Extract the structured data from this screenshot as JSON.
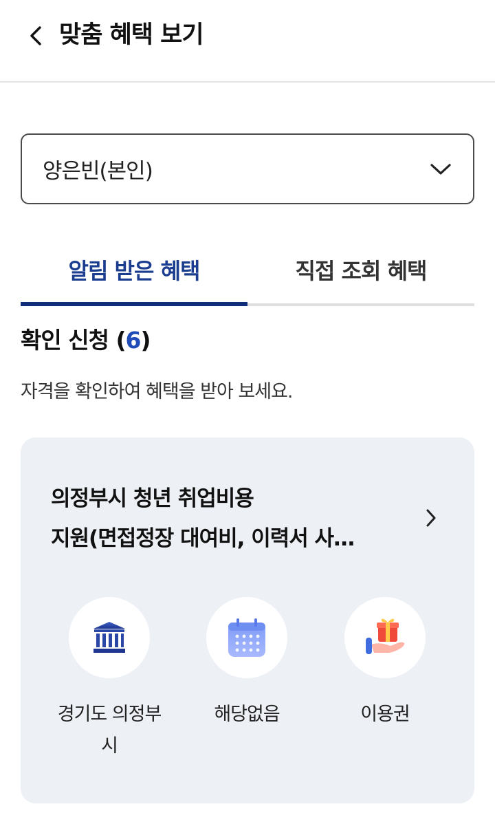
{
  "header": {
    "title": "맞춤 혜택 보기",
    "back_icon": "chevron-left-icon"
  },
  "member_select": {
    "value": "양은빈(본인)",
    "icon": "chevron-down-icon"
  },
  "tabs": [
    {
      "label": "알림 받은 혜택",
      "active": true
    },
    {
      "label": "직접 조회 혜택",
      "active": false
    }
  ],
  "section": {
    "title": "확인 신청",
    "count": "6",
    "description": "자격을 확인하여 혜택을 받아 보세요."
  },
  "benefit_card": {
    "title_line1": "의정부시 청년 취업비용",
    "title_line2": "지원(면접정장 대여비, 이력서 사…",
    "arrow_icon": "chevron-right-icon",
    "info": [
      {
        "icon": "government-building-icon",
        "label": "경기도 의정부시"
      },
      {
        "icon": "calendar-icon",
        "label": "해당없음"
      },
      {
        "icon": "gift-hand-icon",
        "label": "이용권"
      }
    ]
  },
  "colors": {
    "accent": "#1a3d8f",
    "count": "#1f4bb8",
    "card_bg": "#edf0f5"
  }
}
